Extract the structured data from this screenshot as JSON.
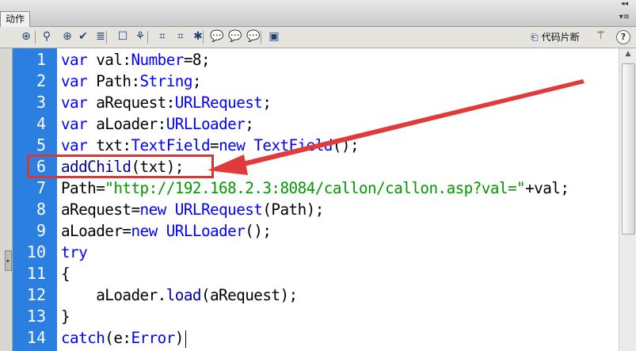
{
  "panel": {
    "tab_label": "动作",
    "collapse_glyph": "◂◂",
    "menu_glyph": "▾≡"
  },
  "toolbar": {
    "buttons": [
      {
        "icon": "add-statement-icon",
        "glyph": "⊕"
      },
      {
        "icon": "find-icon",
        "glyph": "⚲"
      },
      {
        "icon": "insert-target-path-icon",
        "glyph": "⊕"
      },
      {
        "icon": "check-syntax-icon",
        "glyph": "✔"
      },
      {
        "icon": "auto-format-icon",
        "glyph": "≣"
      },
      {
        "icon": "show-code-hint-icon",
        "glyph": "☐"
      },
      {
        "icon": "debug-options-icon",
        "glyph": "⚘"
      },
      {
        "icon": "collapse-between-braces-icon",
        "glyph": "⌗"
      },
      {
        "icon": "collapse-selection-icon",
        "glyph": "⌗"
      },
      {
        "icon": "expand-all-icon",
        "glyph": "✱"
      },
      {
        "icon": "apply-block-comment-icon",
        "glyph": "💬"
      },
      {
        "icon": "apply-line-comment-icon",
        "glyph": "💬"
      },
      {
        "icon": "remove-comment-icon",
        "glyph": "💬"
      },
      {
        "icon": "show-hide-toolbox-icon",
        "glyph": "▣"
      }
    ],
    "snippet_label": "代码片断",
    "snippet_icon": "code-snippet-icon",
    "wand_icon": "script-assist-wand-icon",
    "help_label": "?"
  },
  "editor": {
    "lines": [
      {
        "n": "1",
        "tokens": [
          {
            "t": "var",
            "c": "kw"
          },
          {
            "t": " val:"
          },
          {
            "t": "Number",
            "c": "ty"
          },
          {
            "t": "=8;"
          }
        ]
      },
      {
        "n": "2",
        "tokens": [
          {
            "t": "var",
            "c": "kw"
          },
          {
            "t": " Path:"
          },
          {
            "t": "String",
            "c": "ty"
          },
          {
            "t": ";"
          }
        ]
      },
      {
        "n": "3",
        "tokens": [
          {
            "t": "var",
            "c": "kw"
          },
          {
            "t": " aRequest:"
          },
          {
            "t": "URLRequest",
            "c": "ty"
          },
          {
            "t": ";"
          }
        ]
      },
      {
        "n": "4",
        "tokens": [
          {
            "t": "var",
            "c": "kw"
          },
          {
            "t": " aLoader:"
          },
          {
            "t": "URLLoader",
            "c": "ty"
          },
          {
            "t": ";"
          }
        ]
      },
      {
        "n": "5",
        "tokens": [
          {
            "t": "var",
            "c": "kw"
          },
          {
            "t": " txt:"
          },
          {
            "t": "TextField",
            "c": "ty"
          },
          {
            "t": "="
          },
          {
            "t": "new",
            "c": "kw"
          },
          {
            "t": " "
          },
          {
            "t": "TextField",
            "c": "ty"
          },
          {
            "t": "();"
          }
        ]
      },
      {
        "n": "6",
        "tokens": [
          {
            "t": "addChild",
            "c": "fn"
          },
          {
            "t": "(txt);"
          }
        ]
      },
      {
        "n": "7",
        "tokens": [
          {
            "t": "Path="
          },
          {
            "t": "\"http://192.168.2.3:8084/callon/callon.asp?val=\"",
            "c": "str"
          },
          {
            "t": "+val;"
          }
        ]
      },
      {
        "n": "8",
        "tokens": [
          {
            "t": "aRequest="
          },
          {
            "t": "new",
            "c": "kw"
          },
          {
            "t": " "
          },
          {
            "t": "URLRequest",
            "c": "ty"
          },
          {
            "t": "(Path);"
          }
        ]
      },
      {
        "n": "9",
        "tokens": [
          {
            "t": "aLoader="
          },
          {
            "t": "new",
            "c": "kw"
          },
          {
            "t": " "
          },
          {
            "t": "URLLoader",
            "c": "ty"
          },
          {
            "t": "();"
          }
        ]
      },
      {
        "n": "10",
        "tokens": [
          {
            "t": "try",
            "c": "kw"
          }
        ]
      },
      {
        "n": "11",
        "tokens": [
          {
            "t": "{"
          }
        ]
      },
      {
        "n": "12",
        "tokens": [
          {
            "t": "    aLoader."
          },
          {
            "t": "load",
            "c": "fn"
          },
          {
            "t": "(aRequest);"
          }
        ]
      },
      {
        "n": "13",
        "tokens": [
          {
            "t": "}"
          }
        ]
      },
      {
        "n": "14",
        "tokens": [
          {
            "t": "catch",
            "c": "kw"
          },
          {
            "t": "(e:"
          },
          {
            "t": "Error",
            "c": "ty"
          },
          {
            "t": ")"
          }
        ],
        "caret": true
      }
    ]
  },
  "annotation": {
    "highlighted_line": "6",
    "color": "#d23a3a"
  },
  "colors": {
    "gutter": "#2b7fe0",
    "keyword": "#0000ff",
    "string": "#009900"
  }
}
